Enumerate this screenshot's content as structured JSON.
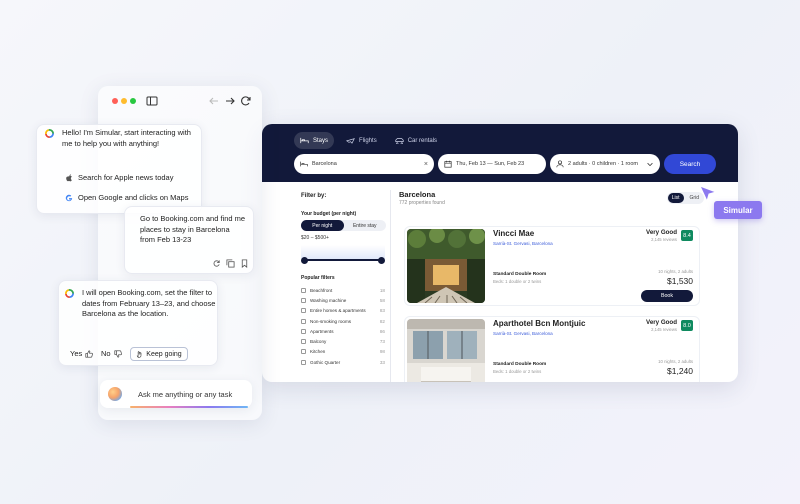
{
  "booking": {
    "tabs": [
      {
        "label": "Stays",
        "icon": "bed-icon",
        "active": true
      },
      {
        "label": "Flights",
        "icon": "plane-icon",
        "active": false
      },
      {
        "label": "Car rentals",
        "icon": "car-icon",
        "active": false
      }
    ],
    "search": {
      "destination": "Barcelona",
      "dates": "Thu, Feb 13  —  Sun, Feb 23",
      "guests": "2 adults · 0 children · 1 room",
      "button": "Search"
    },
    "filters": {
      "title": "Filter by:",
      "budget_label": "Your budget (per night)",
      "budget_options": [
        "Per night",
        "Entire stay"
      ],
      "budget_range": "$20 – $500+",
      "popular_title": "Popular filters",
      "items": [
        {
          "label": "Beachfront",
          "count": "18"
        },
        {
          "label": "Washing machine",
          "count": "58"
        },
        {
          "label": "Entire homes & apartments",
          "count": "83"
        },
        {
          "label": "Non-smoking rooms",
          "count": "82"
        },
        {
          "label": "Apartments",
          "count": "86"
        },
        {
          "label": "Balcony",
          "count": "73"
        },
        {
          "label": "Kitchen",
          "count": "98"
        },
        {
          "label": "Gothic Quarter",
          "count": "33"
        }
      ]
    },
    "results": {
      "title": "Barcelona",
      "subtitle": "772 properties found",
      "view_options": [
        "List",
        "Grid"
      ],
      "cards": [
        {
          "name": "Vincci Mae",
          "area": "Sarrià-St. Gervasi, Barcelona",
          "room": "Standard Double Room",
          "beds": "Beds: 1 double or 2 twins",
          "rating_word": "Very Good",
          "reviews": "2,145 reviews",
          "score": "8.4",
          "nights": "10 nights, 2 adults",
          "price": "$1,530",
          "button": "Book"
        },
        {
          "name": "Aparthotel Bcn Montjuic",
          "area": "Sarrià-St. Gervasi, Barcelona",
          "room": "Standard Double Room",
          "beds": "Beds: 1 double or 2 twins",
          "rating_word": "Very Good",
          "reviews": "2,145 reviews",
          "score": "8.0",
          "nights": "10 nights, 2 adults",
          "price": "$1,240",
          "button": "Book"
        }
      ]
    }
  },
  "agent_tag": "Simular",
  "chat": {
    "window_controls": {
      "colors": [
        "#ff5f57",
        "#febc2e",
        "#28c840"
      ]
    },
    "greeting": [
      "Hello! I'm Simular, start interacting with",
      "me to help you with anything!"
    ],
    "suggestions": [
      {
        "label": "Search for Apple news today",
        "icon": "apple-icon"
      },
      {
        "label": "Open Google and clicks on Maps",
        "icon": "google-icon"
      }
    ],
    "user_message": [
      "Go to Booking.com and find me",
      "places to stay in Barcelona",
      "from Feb 13-23"
    ],
    "agent_reply": [
      "I will open Booking.com, set the filter to",
      "dates from February 13–23, and choose",
      "Barcelona as the location."
    ],
    "yes_label": "Yes",
    "no_label": "No",
    "keep_going_label": "Keep going",
    "input_placeholder": "Ask me anything or any task"
  }
}
